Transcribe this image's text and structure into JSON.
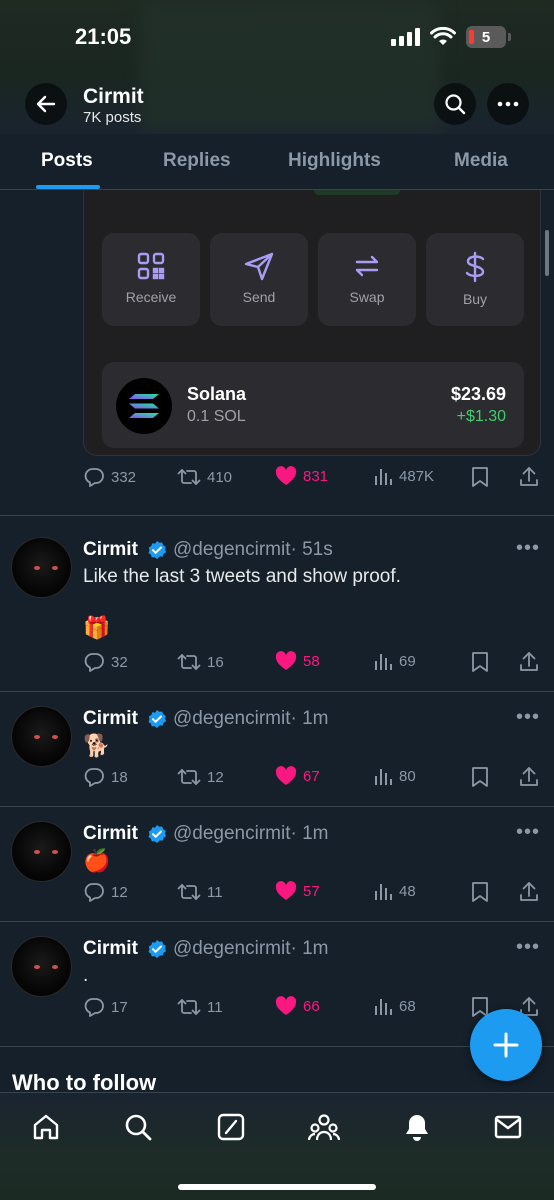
{
  "status": {
    "time": "21:05",
    "battery": "5"
  },
  "header": {
    "title": "Cirmit",
    "subtitle": "7K posts"
  },
  "tabs": [
    "Posts",
    "Replies",
    "Highlights",
    "Media"
  ],
  "wallet": {
    "actions": [
      "Receive",
      "Send",
      "Swap",
      "Buy"
    ],
    "token": {
      "name": "Solana",
      "amount": "0.1 SOL",
      "usd": "$23.69",
      "change": "+$1.30"
    }
  },
  "pinned_stats": {
    "replies": "332",
    "reposts": "410",
    "likes": "831",
    "views": "487K"
  },
  "tweets": [
    {
      "name": "Cirmit",
      "handle": "@degencirmit",
      "time": "· 51s",
      "text": "Like the last 3 tweets and show proof.",
      "emoji": "🎁",
      "replies": "32",
      "reposts": "16",
      "likes": "58",
      "views": "69"
    },
    {
      "name": "Cirmit",
      "handle": "@degencirmit",
      "time": "· 1m",
      "text": "",
      "emoji": "🐕",
      "replies": "18",
      "reposts": "12",
      "likes": "67",
      "views": "80"
    },
    {
      "name": "Cirmit",
      "handle": "@degencirmit",
      "time": "· 1m",
      "text": "",
      "emoji": "🍎",
      "replies": "12",
      "reposts": "11",
      "likes": "57",
      "views": "48"
    },
    {
      "name": "Cirmit",
      "handle": "@degencirmit",
      "time": "· 1m",
      "text": ".",
      "emoji": "",
      "replies": "17",
      "reposts": "11",
      "likes": "66",
      "views": "68"
    }
  ],
  "who_to_follow": "Who to follow",
  "more_glyph": "•••",
  "icons": [
    "back-arrow-icon",
    "search-icon",
    "more-icon",
    "qr-icon",
    "send-icon",
    "swap-icon",
    "dollar-icon",
    "reply-icon",
    "repost-icon",
    "heart-icon",
    "views-icon",
    "bookmark-icon",
    "share-icon",
    "verified-icon",
    "plus-icon",
    "home-icon",
    "grok-icon",
    "communities-icon",
    "bell-icon",
    "mail-icon"
  ],
  "colors": {
    "accent": "#1d9bf0",
    "like": "#f91880",
    "gain": "#3fcf6a",
    "bg": "#15202b"
  }
}
